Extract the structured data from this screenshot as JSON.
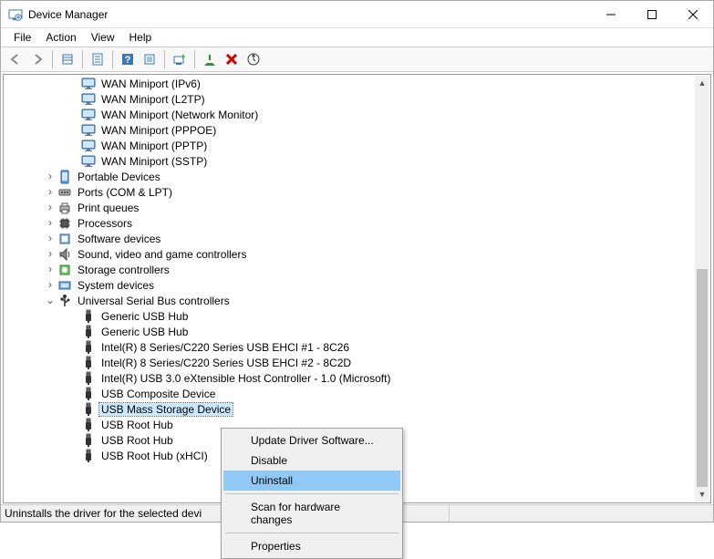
{
  "window": {
    "title": "Device Manager"
  },
  "menubar": {
    "items": [
      "File",
      "Action",
      "View",
      "Help"
    ]
  },
  "toolbar": {
    "icons": [
      "nav-back",
      "nav-forward",
      "show-hidden",
      "properties",
      "help",
      "refresh",
      "update-driver",
      "enable",
      "uninstall",
      "scan-hardware"
    ]
  },
  "tree": {
    "wan": [
      "WAN Miniport (IPv6)",
      "WAN Miniport (L2TP)",
      "WAN Miniport (Network Monitor)",
      "WAN Miniport (PPPOE)",
      "WAN Miniport (PPTP)",
      "WAN Miniport (SSTP)"
    ],
    "categories": [
      {
        "label": "Portable Devices",
        "collapsed": true
      },
      {
        "label": "Ports (COM & LPT)",
        "collapsed": true
      },
      {
        "label": "Print queues",
        "collapsed": true
      },
      {
        "label": "Processors",
        "collapsed": true
      },
      {
        "label": "Software devices",
        "collapsed": true
      },
      {
        "label": "Sound, video and game controllers",
        "collapsed": true
      },
      {
        "label": "Storage controllers",
        "collapsed": true
      },
      {
        "label": "System devices",
        "collapsed": true
      }
    ],
    "usb_category": "Universal Serial Bus controllers",
    "usb": [
      "Generic USB Hub",
      "Generic USB Hub",
      "Intel(R) 8 Series/C220 Series USB EHCI #1 - 8C26",
      "Intel(R) 8 Series/C220 Series USB EHCI #2 - 8C2D",
      "Intel(R) USB 3.0 eXtensible Host Controller - 1.0 (Microsoft)",
      "USB Composite Device",
      "USB Mass Storage Device",
      "USB Root Hub",
      "USB Root Hub",
      "USB Root Hub (xHCI)"
    ],
    "selected_usb_index": 6
  },
  "context_menu": {
    "items": [
      "Update Driver Software...",
      "Disable",
      "Uninstall",
      "Scan for hardware changes",
      "Properties"
    ],
    "highlighted": "Uninstall"
  },
  "statusbar": {
    "text": "Uninstalls the driver for the selected devi"
  }
}
